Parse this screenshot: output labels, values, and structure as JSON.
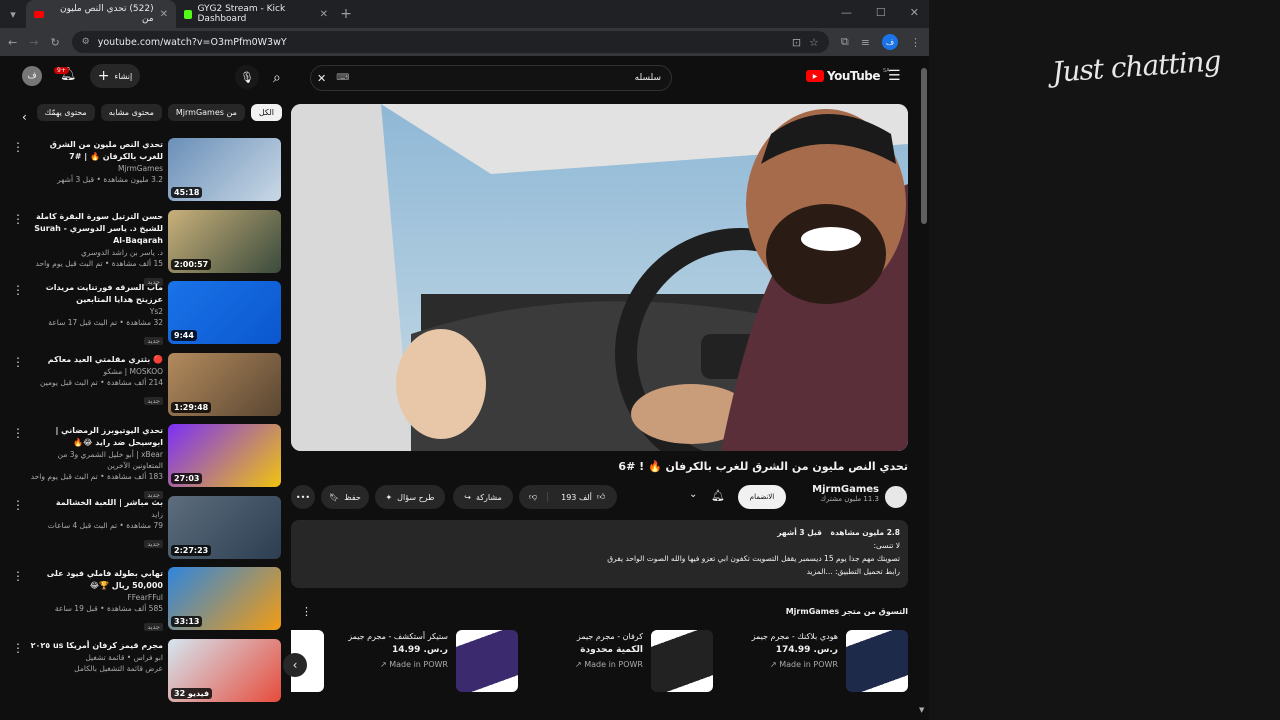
{
  "browser": {
    "tabs": [
      {
        "title": "(522) تحدي النص مليون من",
        "favicon_color": "#ff0000",
        "active": true
      },
      {
        "title": "GYG2 Stream - Kick Dashboard",
        "favicon_color": "#53fc18",
        "active": false
      }
    ],
    "url": "youtube.com/watch?v=O3mPfm0W3wY",
    "profile_initial": "ف"
  },
  "masthead": {
    "logo": "YouTube",
    "region": "SA",
    "search_value": "سلسله",
    "create_label": "إنشاء",
    "notif_count": "9+",
    "avatar_initial": "ف"
  },
  "chips": [
    "الكل",
    "من MjrmGames",
    "محتوى مشابه",
    "محتوى يهمّك"
  ],
  "recommendations": [
    {
      "title": "تحدي النص مليون من الشرق للغرب بالكرفان 🔥 | #7",
      "channel": "MjrmGames",
      "meta": "3.2 مليون مشاهدة • قبل 3 أشهر",
      "duration": "45:18",
      "badge": "",
      "thumb": [
        "#6a8fb8",
        "#c9d8e6"
      ]
    },
    {
      "title": "حسن الترتيل سورة البقرة كاملة للشيخ د. ياسر الدوسري - Surah Al-Baqarah",
      "channel": "د. ياسر بن راشد الدوسري",
      "meta": "15 ألف مشاهدة • تم البث قبل يوم واحد",
      "duration": "2:00:57",
      "badge": "جديد",
      "thumb": [
        "#c9b07a",
        "#3a4b3c"
      ]
    },
    {
      "title": "ماب السرقه فورتنايت مريدات عرزيتح هدايا المتابعين",
      "channel": "Ys2",
      "meta": "32 مشاهدة • تم البث قبل 17 ساعة",
      "duration": "9:44",
      "badge": "جديد",
      "thumb": [
        "#1a73e8",
        "#0b57d0"
      ]
    },
    {
      "title": "🔴 بثتري مقلمتي العيد معاكم",
      "channel": "MOSKOO | مشكو",
      "meta": "214 ألف مشاهدة • تم البث قبل يومين",
      "duration": "1:29:48",
      "badge": "جديد",
      "thumb": [
        "#b38b5d",
        "#5a4632"
      ]
    },
    {
      "title": "تحدي اليوتيوبرز الرمضاني | ابوسيحل ضد رايد 😂🔥",
      "channel": "xBear | أبو خليل الشمري و3 من المتعاونين الآخرين",
      "meta": "183 ألف مشاهدة • تم البث قبل يوم واحد",
      "duration": "27:03",
      "badge": "جديد",
      "thumb": [
        "#7b2ff7",
        "#f1c40f"
      ]
    },
    {
      "title": "بث مباشر | اللعبة الخشالمة",
      "channel": "زايد",
      "meta": "79 مشاهدة • تم البث قبل 4 ساعات",
      "duration": "2:27:23",
      "badge": "جديد",
      "thumb": [
        "#5d6d7e",
        "#2c3e50"
      ]
    },
    {
      "title": "تهابي بطولة فاملي فيود على 50,000 ريال 🏆😂",
      "channel": "FFearFFul",
      "meta": "585 ألف مشاهدة • قبل 19 ساعة",
      "duration": "33:13",
      "badge": "جديد",
      "thumb": [
        "#2e86de",
        "#f39c12"
      ]
    },
    {
      "title": "مجرم قيمز كرفان أمريكا us ٢٠٢٥",
      "channel": "ابو فراس • قائمة تشغيل",
      "meta": "عرض قائمة التشغيل بالكامل",
      "duration": "32 فيديو",
      "badge": "",
      "thumb": [
        "#d4e6f1",
        "#e74c3c"
      ]
    }
  ],
  "video": {
    "title": "تحدي النص مليون من الشرق للغرب بالكرفان 🔥 ! #6",
    "channel": "MjrmGames",
    "subscribers": "11.3 مليون مشترك",
    "join_label": "الانضمام",
    "likes": "193 ألف",
    "share_label": "مشاركة",
    "ask_label": "طرح سؤال",
    "save_label": "حفظ"
  },
  "description": {
    "views": "2.8 مليون مشاهدة",
    "date": "قبل 3 أشهر",
    "line1": "لا تنسى:",
    "line2": "تصويتك مهم جدا يوم 15 ديسمبر يقفل التصويت تكفون ابي تعزو فيها والله الصوت الواحد يفرق",
    "line3": "رابط تحميل التطبيق: ...المزيد"
  },
  "shop": {
    "header": "التسوق من متجر MjrmGames",
    "products": [
      {
        "name": "هودي بلاكنك - مجرم جيمز",
        "price": "ر.س.‏ 174.99",
        "source": "Made in POWR",
        "img": "#1e2a4a"
      },
      {
        "name": "كرفان - مجرم جيمز",
        "price": "الكمية محدودة",
        "source": "Made in POWR",
        "img": "#222"
      },
      {
        "name": "ستيكر أستكشف - مجرم جيمز",
        "price": "ر.س.‏ 14.99",
        "source": "Made in POWR",
        "img": "#3b2a6e"
      }
    ]
  },
  "overlay_text": "Just chatting"
}
